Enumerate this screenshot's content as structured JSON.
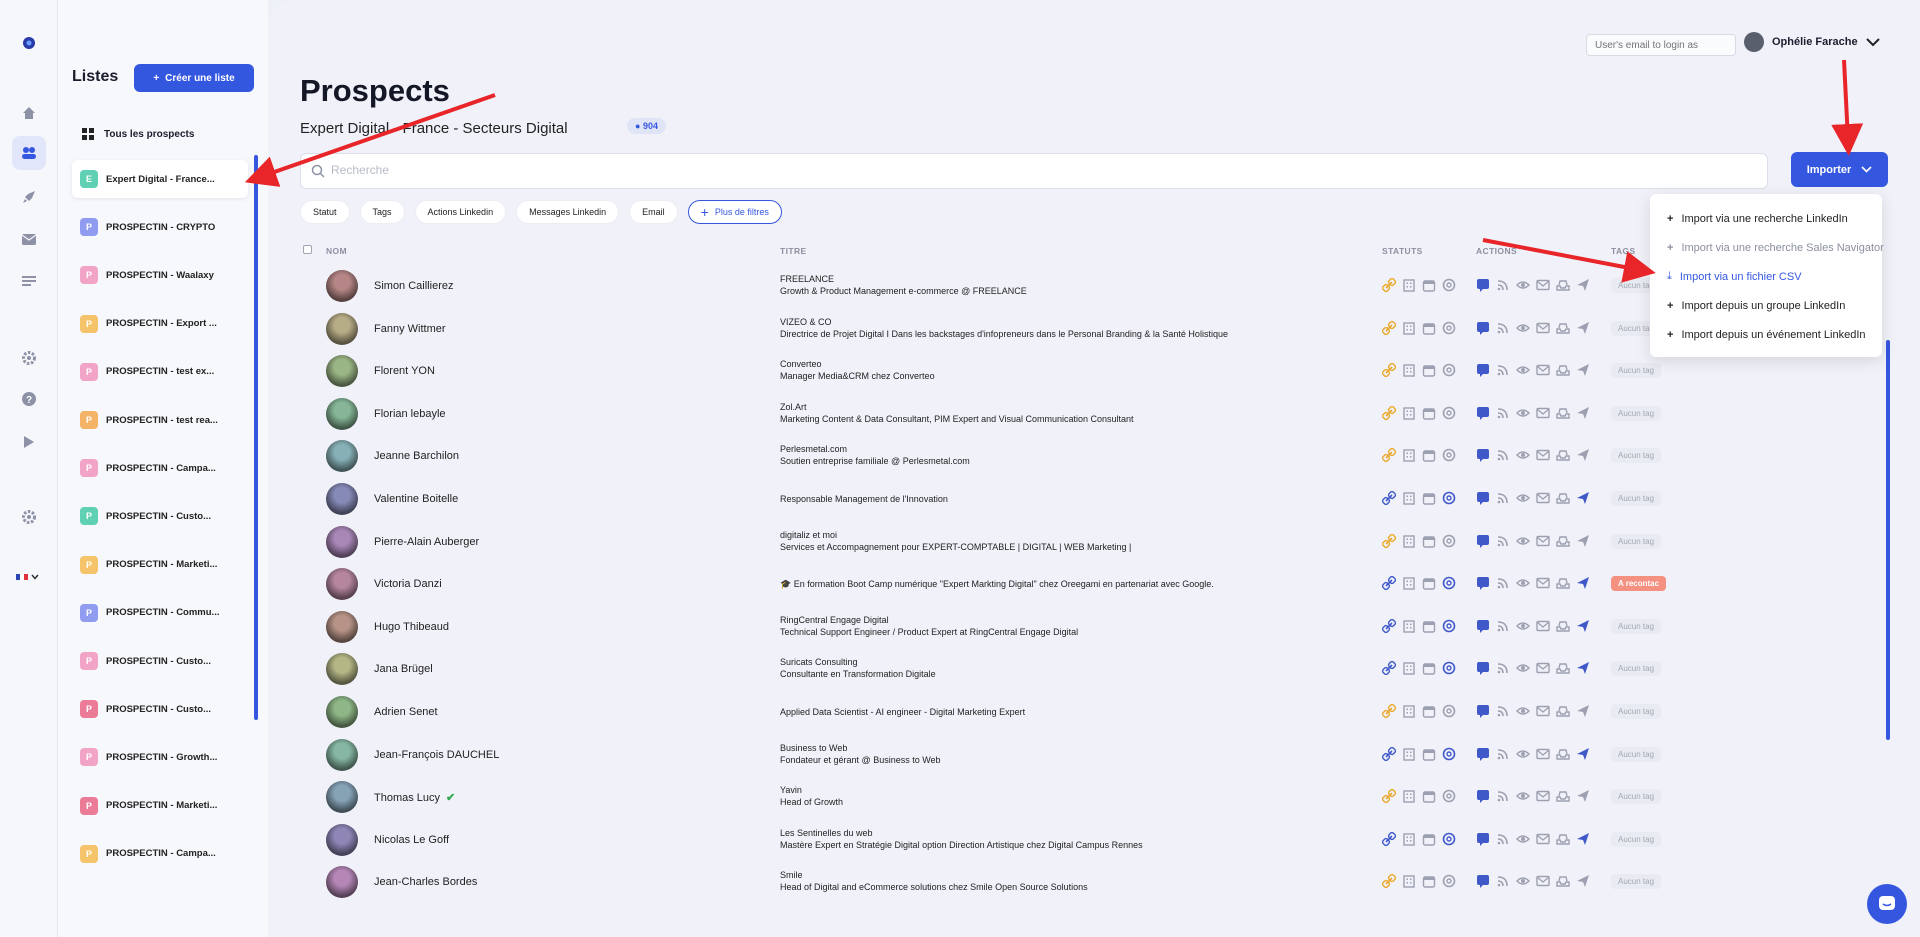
{
  "sidebar_icons": [
    "logo-icon",
    "home-icon",
    "users-icon",
    "rocket-icon",
    "mail-icon",
    "list-icon",
    "gear-icon",
    "help-icon",
    "play-icon",
    "settings-icon",
    "french-flag-icon"
  ],
  "lists_panel": {
    "title": "Listes",
    "create_label": "Créer une liste",
    "all_prospects": "Tous les prospects",
    "items": [
      {
        "letter": "E",
        "label": "Expert Digital - France...",
        "color": "#5fd0b3",
        "active": true
      },
      {
        "letter": "P",
        "label": "PROSPECTIN - CRYPTO",
        "color": "#8f9cf0"
      },
      {
        "letter": "P",
        "label": "PROSPECTIN - Waalaxy",
        "color": "#f2a4c7"
      },
      {
        "letter": "P",
        "label": "PROSPECTIN - Export ...",
        "color": "#f4c36a"
      },
      {
        "letter": "P",
        "label": "PROSPECTIN - test ex...",
        "color": "#f2a4c7"
      },
      {
        "letter": "P",
        "label": "PROSPECTIN - test rea...",
        "color": "#f4b366"
      },
      {
        "letter": "P",
        "label": "PROSPECTIN - Campa...",
        "color": "#f2a4c7"
      },
      {
        "letter": "P",
        "label": "PROSPECTIN - Custo...",
        "color": "#5fd0b3"
      },
      {
        "letter": "P",
        "label": "PROSPECTIN - Marketi...",
        "color": "#f4c36a"
      },
      {
        "letter": "P",
        "label": "PROSPECTIN - Commu...",
        "color": "#8f9cf0"
      },
      {
        "letter": "P",
        "label": "PROSPECTIN - Custo...",
        "color": "#f2a4c7"
      },
      {
        "letter": "P",
        "label": "PROSPECTIN - Custo...",
        "color": "#ec7b98"
      },
      {
        "letter": "P",
        "label": "PROSPECTIN - Growth...",
        "color": "#f2a4c7"
      },
      {
        "letter": "P",
        "label": "PROSPECTIN - Marketi...",
        "color": "#ec7b98"
      },
      {
        "letter": "P",
        "label": "PROSPECTIN - Campa...",
        "color": "#f4c36a"
      }
    ]
  },
  "header": {
    "login_placeholder": "User's email to login as",
    "user_name": "Ophélie Farache",
    "page_title": "Prospects",
    "list_name": "Expert Digital - France - Secteurs Digital",
    "count": "904",
    "search_placeholder": "Recherche",
    "import_label": "Importer"
  },
  "filters": [
    "Statut",
    "Tags",
    "Actions Linkedin",
    "Messages Linkedin",
    "Email"
  ],
  "more_filters": "Plus de filtres",
  "columns": {
    "name": "NOM",
    "title": "TITRE",
    "status": "STATUTS",
    "actions": "ACTIONS",
    "tags": "TAGS"
  },
  "import_menu": [
    {
      "label": "Import via une recherche LinkedIn",
      "icon": "plus-icon",
      "state": "normal"
    },
    {
      "label": "Import via une recherche Sales Navigator",
      "icon": "plus-icon",
      "state": "muted"
    },
    {
      "label": "Import via un fichier CSV",
      "icon": "download-icon",
      "state": "highlight"
    },
    {
      "label": "Import depuis un groupe LinkedIn",
      "icon": "plus-icon",
      "state": "normal"
    },
    {
      "label": "Import depuis un événement LinkedIn",
      "icon": "plus-icon",
      "state": "normal"
    }
  ],
  "prospects": [
    {
      "name": "Simon Caillierez",
      "line1": "FREELANCE",
      "line2": "Growth & Product Management e-commerce @ FREELANCE",
      "tag": "Aucun tag",
      "linked": false,
      "verified": false
    },
    {
      "name": "Fanny Wittmer",
      "line1": "VIZEO & CO",
      "line2": "Directrice de Projet Digital I Dans les backstages d'infopreneurs dans le Personal Branding & la Santé Holistique",
      "tag": "Aucun tag",
      "linked": false,
      "verified": false
    },
    {
      "name": "Florent YON",
      "line1": "Converteo",
      "line2": "Manager Media&CRM chez Converteo",
      "tag": "Aucun tag",
      "linked": false,
      "verified": false
    },
    {
      "name": "Florian lebayle",
      "line1": "Zol.Art",
      "line2": "Marketing Content & Data Consultant, PIM Expert and Visual Communication Consultant",
      "tag": "Aucun tag",
      "linked": false,
      "verified": false
    },
    {
      "name": "Jeanne Barchilon",
      "line1": "Perlesmetal.com",
      "line2": "Soutien entreprise familiale @ Perlesmetal.com",
      "tag": "Aucun tag",
      "linked": false,
      "verified": false
    },
    {
      "name": "Valentine Boitelle",
      "line1": "Responsable Management de l'Innovation",
      "line2": "",
      "tag": "Aucun tag",
      "linked": true,
      "verified": false
    },
    {
      "name": "Pierre-Alain Auberger",
      "line1": "digitaliz et moi",
      "line2": "Services et Accompagnement pour EXPERT-COMPTABLE | DIGITAL | WEB Marketing |",
      "tag": "Aucun tag",
      "linked": false,
      "verified": false
    },
    {
      "name": "Victoria Danzi",
      "line1": "🎓 En formation Boot Camp numérique \"Expert Markting Digital\" chez Oreegami en partenariat avec Google.",
      "line2": "",
      "tag": "A recontac",
      "linked": true,
      "verified": false,
      "tag_red": true
    },
    {
      "name": "Hugo Thibeaud",
      "line1": "RingCentral Engage Digital",
      "line2": "Technical Support Engineer / Product Expert at RingCentral Engage Digital",
      "tag": "Aucun tag",
      "linked": true,
      "verified": false
    },
    {
      "name": "Jana Brügel",
      "line1": "Suricats Consulting",
      "line2": "Consultante en Transformation Digitale",
      "tag": "Aucun tag",
      "linked": true,
      "verified": false
    },
    {
      "name": "Adrien Senet",
      "line1": "Applied Data Scientist - AI engineer - Digital Marketing Expert",
      "line2": "",
      "tag": "Aucun tag",
      "linked": false,
      "verified": false
    },
    {
      "name": "Jean-François DAUCHEL",
      "line1": "Business to Web",
      "line2": "Fondateur et gérant @ Business to Web",
      "tag": "Aucun tag",
      "linked": true,
      "verified": false
    },
    {
      "name": "Thomas Lucy",
      "line1": "Yavin",
      "line2": "Head of Growth",
      "tag": "Aucun tag",
      "linked": false,
      "verified": true
    },
    {
      "name": "Nicolas Le Goff",
      "line1": "Les Sentinelles du web",
      "line2": "Mastère Expert en Stratégie Digital option Direction Artistique chez Digital Campus Rennes",
      "tag": "Aucun tag",
      "linked": true,
      "verified": false
    },
    {
      "name": "Jean-Charles Bordes",
      "line1": "Smile",
      "line2": "Head of Digital and eCommerce solutions chez Smile Open Source Solutions",
      "tag": "Aucun tag",
      "linked": false,
      "verified": false
    }
  ],
  "colors": {
    "accent": "#3557e0",
    "annotation_red": "#e8262a",
    "link_gold": "#e9a82c"
  }
}
